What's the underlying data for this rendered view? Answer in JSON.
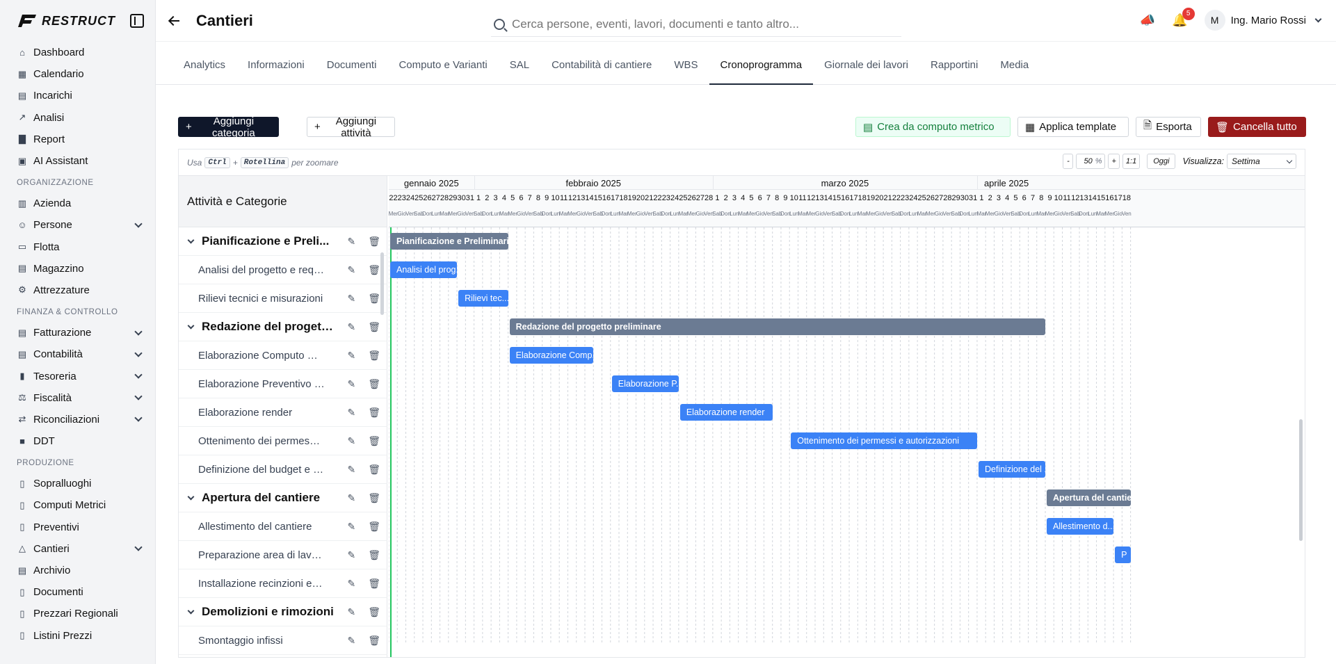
{
  "brand": {
    "name": "RESTRUCT"
  },
  "sidebar": {
    "items_main": [
      {
        "label": "Dashboard",
        "icon": "home-icon"
      },
      {
        "label": "Calendario",
        "icon": "calendar-icon"
      },
      {
        "label": "Incarichi",
        "icon": "clipboard-icon"
      },
      {
        "label": "Analisi",
        "icon": "analytics-icon"
      },
      {
        "label": "Report",
        "icon": "bar-chart-icon"
      },
      {
        "label": "AI Assistant",
        "icon": "robot-icon"
      }
    ],
    "section_org": "ORGANIZZAZIONE",
    "items_org": [
      {
        "label": "Azienda",
        "icon": "building-icon"
      },
      {
        "label": "Persone",
        "icon": "users-icon",
        "chevron": true
      },
      {
        "label": "Flotta",
        "icon": "truck-icon"
      },
      {
        "label": "Magazzino",
        "icon": "warehouse-icon"
      },
      {
        "label": "Attrezzature",
        "icon": "gear-icon"
      }
    ],
    "section_fin": "FINANZA & CONTROLLO",
    "items_fin": [
      {
        "label": "Fatturazione",
        "icon": "invoice-icon",
        "chevron": true
      },
      {
        "label": "Contabilità",
        "icon": "ledger-icon",
        "chevron": true
      },
      {
        "label": "Tesoreria",
        "icon": "bank-icon",
        "chevron": true
      },
      {
        "label": "Fiscalità",
        "icon": "tax-icon",
        "chevron": true
      },
      {
        "label": "Riconciliazioni",
        "icon": "reconcile-icon",
        "chevron": true
      },
      {
        "label": "DDT",
        "icon": "box-icon"
      }
    ],
    "section_prod": "PRODUZIONE",
    "items_prod": [
      {
        "label": "Sopralluoghi",
        "icon": "document-icon"
      },
      {
        "label": "Computi Metrici",
        "icon": "document-icon"
      },
      {
        "label": "Preventivi",
        "icon": "document-icon"
      },
      {
        "label": "Cantieri",
        "icon": "crane-icon",
        "chevron": true
      },
      {
        "label": "Archivio",
        "icon": "archive-icon"
      },
      {
        "label": "Documenti",
        "icon": "document-icon"
      },
      {
        "label": "Prezzari Regionali",
        "icon": "document-icon"
      },
      {
        "label": "Listini Prezzi",
        "icon": "document-icon"
      }
    ]
  },
  "header": {
    "title": "Cantieri",
    "search_placeholder": "Cerca persone, eventi, lavori, documenti e tanto altro...",
    "notifications": "5",
    "user_initial": "M",
    "user_name": "Ing. Mario Rossi"
  },
  "tabs": [
    "Analytics",
    "Informazioni",
    "Documenti",
    "Computo e Varianti",
    "SAL",
    "Contabilità di cantiere",
    "WBS",
    "Cronoprogramma",
    "Giornale dei lavori",
    "Rapportini",
    "Media"
  ],
  "active_tab": "Cronoprogramma",
  "toolbar": {
    "add_category": "Aggiungi categoria",
    "add_activity": "Aggiungi attività",
    "from_computo": "Crea da computo metrico",
    "apply_template": "Applica template",
    "export": "Esporta",
    "delete_all": "Cancella tutto"
  },
  "zoom": {
    "hint_use": "Usa",
    "key1": "Ctrl",
    "plus": "+",
    "key2": "Rotellina",
    "hint_end": "per zoomare",
    "minus": "-",
    "value": "50",
    "percent": "%",
    "zplus": "+",
    "reset": "1:1",
    "today": "Oggi",
    "view_label": "Visualizza:",
    "view_value": "Settima"
  },
  "gantt": {
    "column_header": "Attività e Categorie",
    "months": [
      {
        "label": "gennaio 2025",
        "start": 0,
        "days": 10
      },
      {
        "label": "febbraio 2025",
        "start": 10,
        "days": 28
      },
      {
        "label": "marzo 2025",
        "start": 38,
        "days": 31
      },
      {
        "label": "aprile 2025",
        "start": 69,
        "days": 18
      }
    ],
    "day_numbers": [
      "22",
      "23",
      "24",
      "25",
      "26",
      "27",
      "28",
      "29",
      "30",
      "31",
      "1",
      "2",
      "3",
      "4",
      "5",
      "6",
      "7",
      "8",
      "9",
      "10",
      "11",
      "12",
      "13",
      "14",
      "15",
      "16",
      "17",
      "18",
      "19",
      "20",
      "21",
      "22",
      "23",
      "24",
      "25",
      "26",
      "27",
      "28",
      "1",
      "2",
      "3",
      "4",
      "5",
      "6",
      "7",
      "8",
      "9",
      "10",
      "11",
      "12",
      "13",
      "14",
      "15",
      "16",
      "17",
      "18",
      "19",
      "20",
      "21",
      "22",
      "23",
      "24",
      "25",
      "26",
      "27",
      "28",
      "29",
      "30",
      "31",
      "1",
      "2",
      "3",
      "4",
      "5",
      "6",
      "7",
      "8",
      "9",
      "10",
      "11",
      "12",
      "13",
      "14",
      "15",
      "16",
      "17",
      "18"
    ],
    "weekday_cycle": [
      "Mer",
      "Gio",
      "Ven",
      "Sab",
      "Dom",
      "Lun",
      "Mar"
    ],
    "rows": [
      {
        "type": "cat",
        "label": "Pianificazione e Preli...",
        "bar": "Pianificazione e Preliminari",
        "start": 0,
        "end": 14
      },
      {
        "type": "act",
        "label": "Analisi del progetto e requi...",
        "bar": "Analisi del prog...",
        "start": 0,
        "end": 8
      },
      {
        "type": "act",
        "label": "Rilievi tecnici e misurazioni",
        "bar": "Rilievi tec...",
        "start": 8,
        "end": 14
      },
      {
        "type": "cat",
        "label": "Redazione del progett...",
        "bar": "Redazione del progetto preliminare",
        "start": 14,
        "end": 77
      },
      {
        "type": "act",
        "label": "Elaborazione Computo Met...",
        "bar": "Elaborazione Comp...",
        "start": 14,
        "end": 24
      },
      {
        "type": "act",
        "label": "Elaborazione Preventivo Di...",
        "bar": "Elaborazione P...",
        "start": 26,
        "end": 34
      },
      {
        "type": "act",
        "label": "Elaborazione render",
        "bar": "Elaborazione render",
        "start": 34,
        "end": 45
      },
      {
        "type": "act",
        "label": "Ottenimento dei permessi ...",
        "bar": "Ottenimento dei permessi e autorizzazioni",
        "start": 47,
        "end": 69
      },
      {
        "type": "act",
        "label": "Definizione del budget e c...",
        "bar": "Definizione del ...",
        "start": 69,
        "end": 77
      },
      {
        "type": "cat",
        "label": "Apertura del cantiere",
        "bar": "Apertura del cantiere",
        "start": 77,
        "end": 87
      },
      {
        "type": "act",
        "label": "Allestimento del cantiere",
        "bar": "Allestimento d...",
        "start": 77,
        "end": 85
      },
      {
        "type": "act",
        "label": "Preparazione area di lavoro",
        "bar": "P",
        "start": 85,
        "end": 87
      },
      {
        "type": "act",
        "label": "Installazione recinzioni e se...",
        "bar": "",
        "start": 87,
        "end": 87
      },
      {
        "type": "cat",
        "label": "Demolizioni e rimozioni",
        "bar": "",
        "start": 87,
        "end": 87
      },
      {
        "type": "act",
        "label": "Smontaggio infissi",
        "bar": "",
        "start": 87,
        "end": 87
      }
    ]
  }
}
